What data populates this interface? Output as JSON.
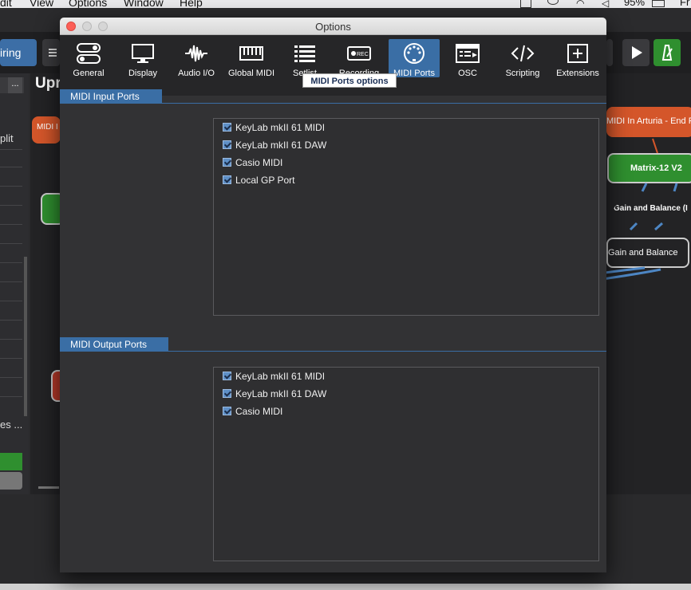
{
  "menubar": {
    "items": [
      "dit",
      "View",
      "Options",
      "Window",
      "Help"
    ],
    "battery": "95%",
    "right_text": "Fr"
  },
  "background_app": {
    "toolbar_label": "iring",
    "sidebar_text_1": "plit",
    "sidebar_text_2": "es ...",
    "sidebar_ellipsis_button": "...",
    "rackspace_title": "Upr",
    "nodes": {
      "midi_in_left": "MIDI I",
      "midi_in_arturia": "MIDI In Arturia - End FX",
      "matrix": "Matrix-12 V2",
      "gain_1": "Gain and Balance (I",
      "gain_2": "Gain and Balance"
    }
  },
  "dialog": {
    "title": "Options",
    "tabs": [
      {
        "label": "General",
        "icon": "toggle-switches-icon"
      },
      {
        "label": "Display",
        "icon": "monitor-icon"
      },
      {
        "label": "Audio I/O",
        "icon": "waveform-icon"
      },
      {
        "label": "Global MIDI",
        "icon": "piano-keys-icon"
      },
      {
        "label": "Setlist",
        "icon": "list-icon"
      },
      {
        "label": "Recording",
        "icon": "rec-icon"
      },
      {
        "label": "MIDI Ports",
        "icon": "midi-din-icon"
      },
      {
        "label": "OSC",
        "icon": "osc-screen-icon"
      },
      {
        "label": "Scripting",
        "icon": "code-brackets-icon"
      },
      {
        "label": "Extensions",
        "icon": "plus-box-icon"
      }
    ],
    "active_tab": "MIDI Ports",
    "tooltip": "MIDI Ports options",
    "rec_badge": "REC",
    "input_section": {
      "title": "MIDI Input Ports",
      "ports": [
        {
          "name": "KeyLab mkII 61 MIDI",
          "checked": true
        },
        {
          "name": "KeyLab mkII 61 DAW",
          "checked": true
        },
        {
          "name": "Casio MIDI",
          "checked": true
        },
        {
          "name": "Local GP Port",
          "checked": true
        }
      ]
    },
    "output_section": {
      "title": "MIDI Output Ports",
      "ports": [
        {
          "name": "KeyLab mkII 61 MIDI",
          "checked": true
        },
        {
          "name": "KeyLab mkII 61 DAW",
          "checked": true
        },
        {
          "name": "Casio MIDI",
          "checked": true
        }
      ]
    }
  },
  "colors": {
    "accent": "#3a6ea5",
    "midi_node": "#d4562a",
    "plugin_node": "#2f8f2f"
  }
}
